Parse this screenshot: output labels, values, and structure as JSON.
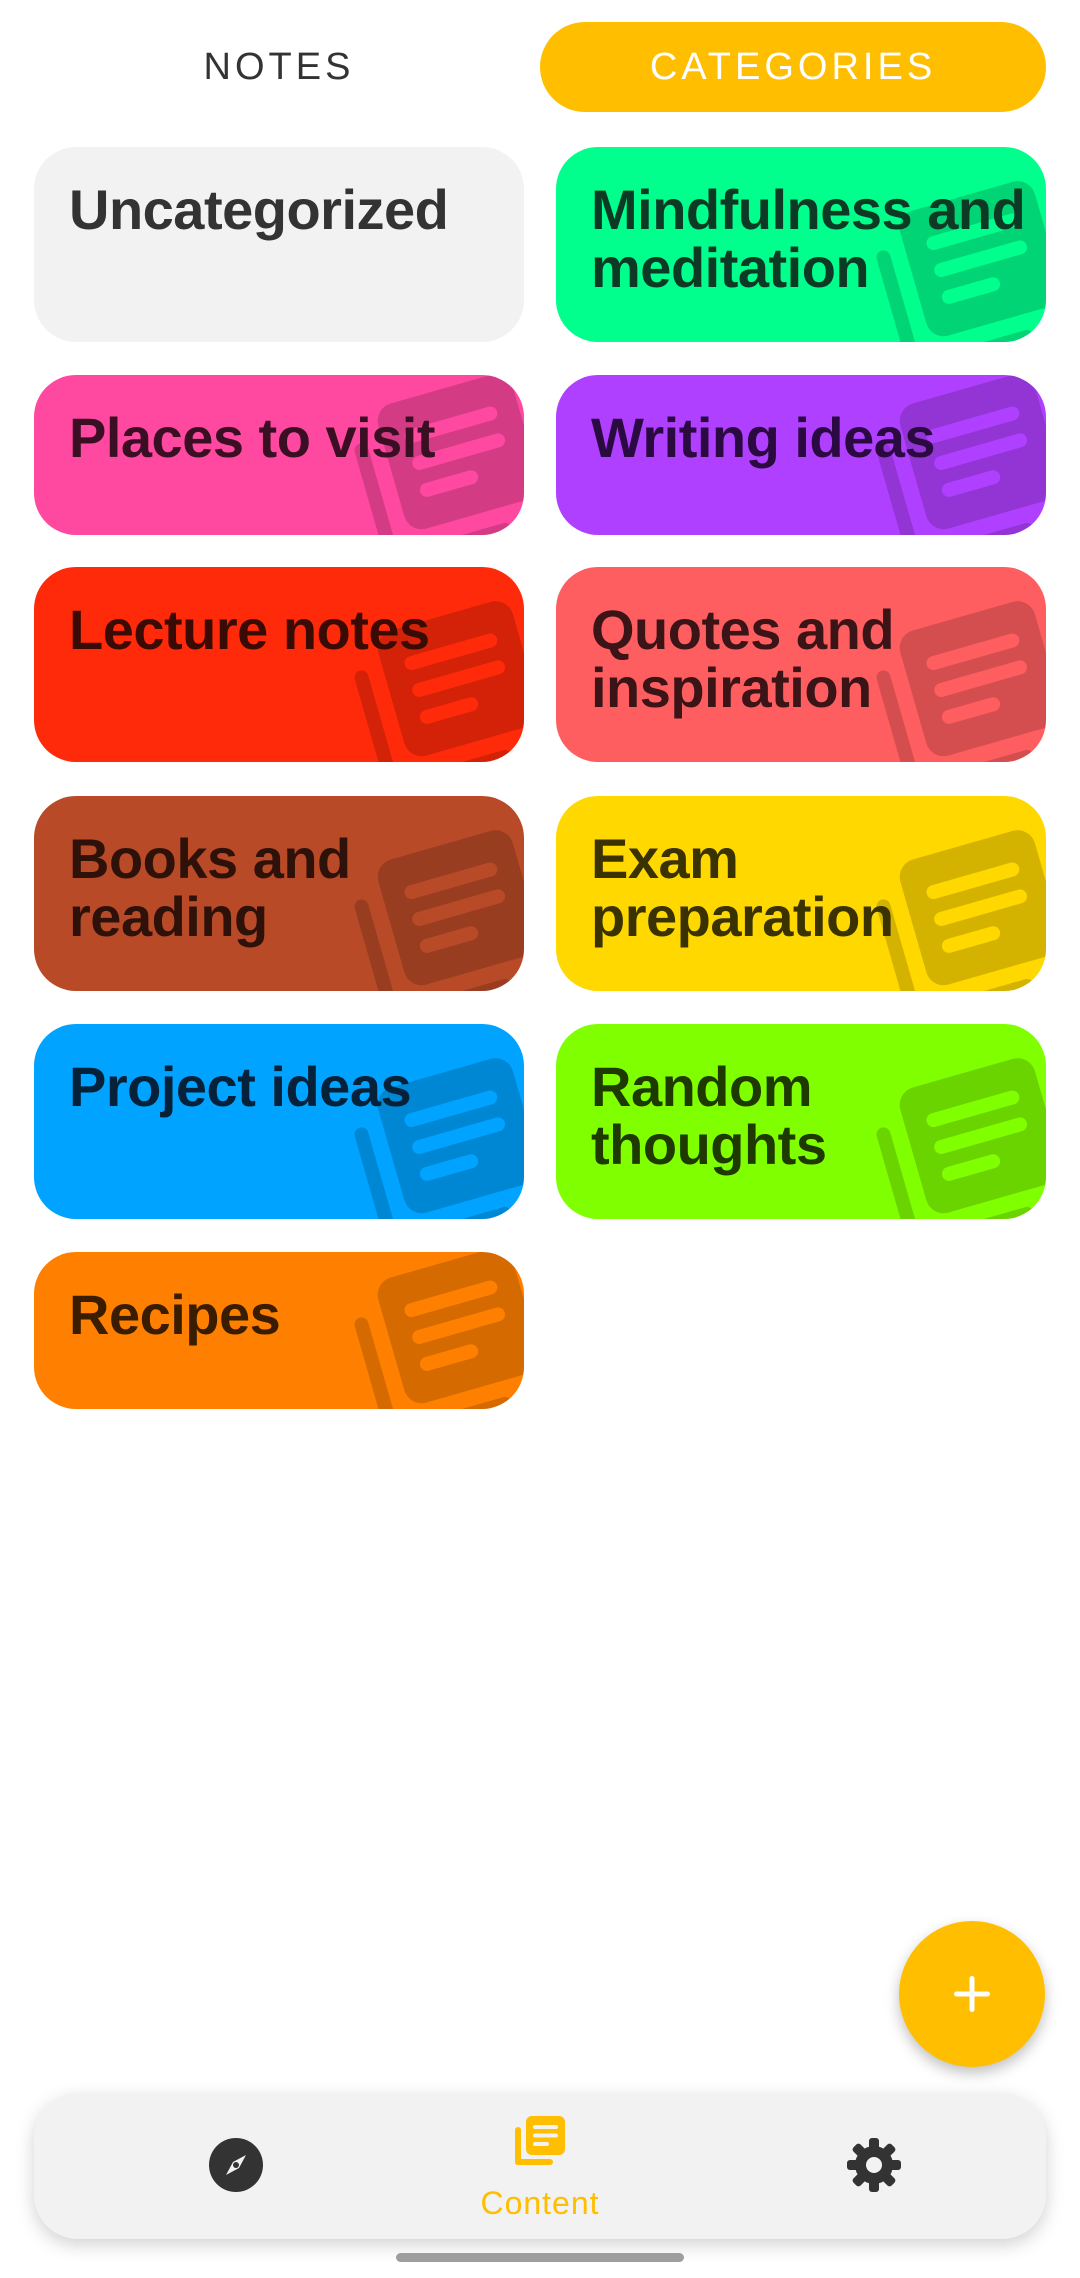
{
  "tabs": {
    "notes": "Notes",
    "categories": "Categories",
    "active": "categories",
    "accent": "#FFBE00"
  },
  "categories": [
    {
      "label": "Uncategorized",
      "color": "#F2F2F2",
      "text_color": "#333333",
      "icon": "notes-icon"
    },
    {
      "label": "Mindfulness and meditation",
      "color": "#00FF8C",
      "text_color": "#0D3A24",
      "icon": "notes-icon"
    },
    {
      "label": "Places to visit",
      "color": "#FF48A0",
      "text_color": "#3A0F24",
      "icon": "notes-icon"
    },
    {
      "label": "Writing ideas",
      "color": "#B040FF",
      "text_color": "#2A0A40",
      "icon": "notes-icon"
    },
    {
      "label": "Lecture notes",
      "color": "#FF2A0A",
      "text_color": "#3A0A04",
      "icon": "notes-icon"
    },
    {
      "label": "Quotes and inspiration",
      "color": "#FF5E60",
      "text_color": "#3A1416",
      "icon": "notes-icon"
    },
    {
      "label": "Books and reading",
      "color": "#B94A28",
      "text_color": "#2E120A",
      "icon": "notes-icon"
    },
    {
      "label": "Exam preparation",
      "color": "#FFD800",
      "text_color": "#3A3200",
      "icon": "notes-icon"
    },
    {
      "label": "Project ideas",
      "color": "#00A3FF",
      "text_color": "#06223A",
      "icon": "notes-icon"
    },
    {
      "label": "Random thoughts",
      "color": "#80FF00",
      "text_color": "#1E3A00",
      "icon": "notes-icon"
    },
    {
      "label": "Recipes",
      "color": "#FF8000",
      "text_color": "#3A1C00",
      "icon": "notes-icon"
    }
  ],
  "fab": {
    "icon": "plus-icon"
  },
  "bottom_nav": {
    "items": [
      {
        "id": "explore",
        "icon": "compass-icon",
        "label": ""
      },
      {
        "id": "content",
        "icon": "notes-stack-icon",
        "label": "Content",
        "active": true
      },
      {
        "id": "settings",
        "icon": "gear-icon",
        "label": ""
      }
    ]
  }
}
